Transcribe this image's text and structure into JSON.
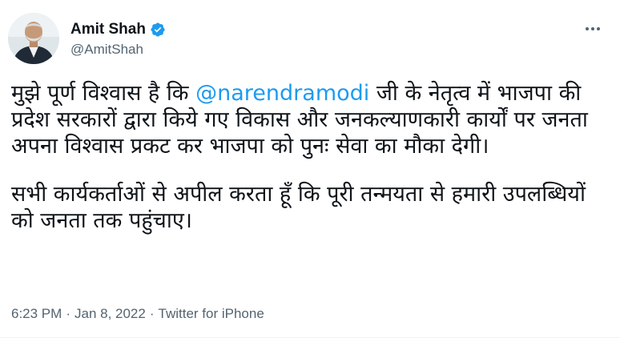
{
  "author": {
    "display_name": "Amit Shah",
    "handle": "@AmitShah",
    "verified_icon": "verified-badge-icon",
    "avatar_icon": "profile-photo"
  },
  "menu": {
    "icon": "more-horizontal-icon"
  },
  "tweet": {
    "p1_before": "मुझे पूर्ण विश्वास है कि ",
    "mention": "@narendramodi",
    "p1_after": " जी के नेतृत्व में भाजपा की प्रदेश सरकारों द्वारा किये गए विकास और जनकल्याणकारी कार्यों पर जनता अपना विश्वास प्रकट कर भाजपा को पुनः सेवा का मौका देगी।",
    "p2": "सभी कार्यकर्ताओं से अपील करता हूँ कि पूरी तन्मयता से हमारी उपलब्धियों को जनता तक पहुंचाए।"
  },
  "meta": {
    "time": "6:23 PM",
    "separator": "·",
    "date": "Jan 8, 2022",
    "source": "Twitter for iPhone"
  },
  "colors": {
    "link": "#1d9bf0",
    "secondary_text": "#536471",
    "primary_text": "#0f1419"
  }
}
